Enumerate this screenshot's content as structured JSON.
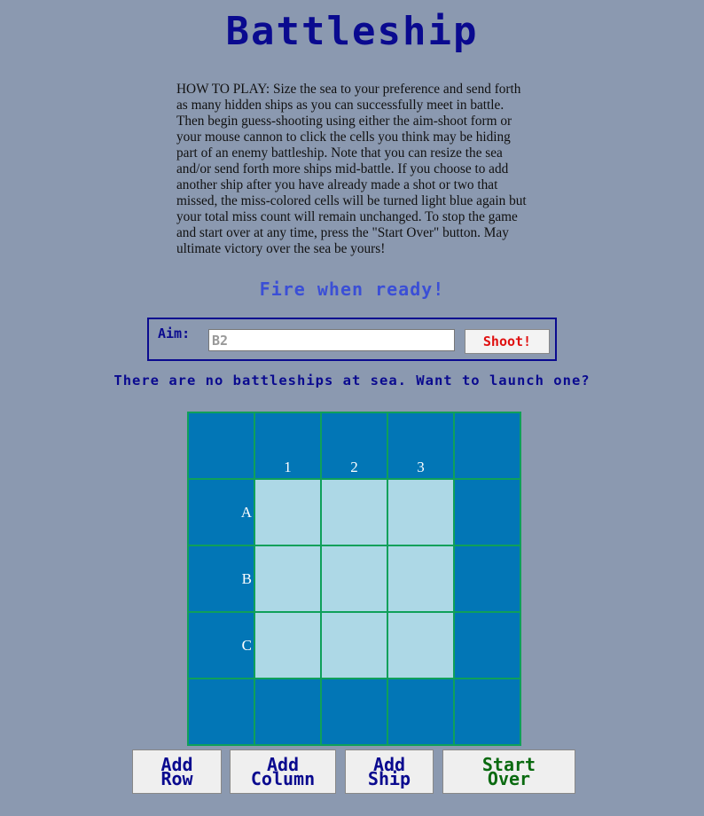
{
  "title": "Battleship",
  "how_to_play": "HOW TO PLAY: Size the sea to your preference and send forth as many hidden ships as you can successfully meet in battle. Then begin guess-shooting using either the aim-shoot form or your mouse cannon to click the cells you think may be hiding part of an enemy battleship. Note that you can resize the sea and/or send forth more ships mid-battle. If you choose to add another ship after you have already made a shot or two that missed, the miss-colored cells will be turned light blue again but your total miss count will remain unchanged. To stop the game and start over at any time, press the \"Start Over\" button. May ultimate victory over the sea be yours!",
  "fire_message": "Fire when ready!",
  "aim": {
    "label": "Aim:",
    "placeholder": "B2",
    "shoot_label": "Shoot!"
  },
  "status_message": "There are no battleships at sea. Want to launch one?",
  "board": {
    "columns": [
      "1",
      "2",
      "3"
    ],
    "rows": [
      "A",
      "B",
      "C"
    ]
  },
  "buttons": {
    "add_row": [
      "Add",
      "Row"
    ],
    "add_column": [
      "Add",
      "Column"
    ],
    "add_ship": [
      "Add",
      "Ship"
    ],
    "start_over": [
      "Start",
      "Over"
    ]
  },
  "colors": {
    "background": "#8b99b0",
    "title": "#0a0a8f",
    "fire_message": "#3b4fd6",
    "shoot_text": "#e01010",
    "start_over_text": "#0a6a10",
    "ocean_border": "#0276b6",
    "sea_cell": "#add8e6",
    "grid_lines": "#0fa05a"
  }
}
